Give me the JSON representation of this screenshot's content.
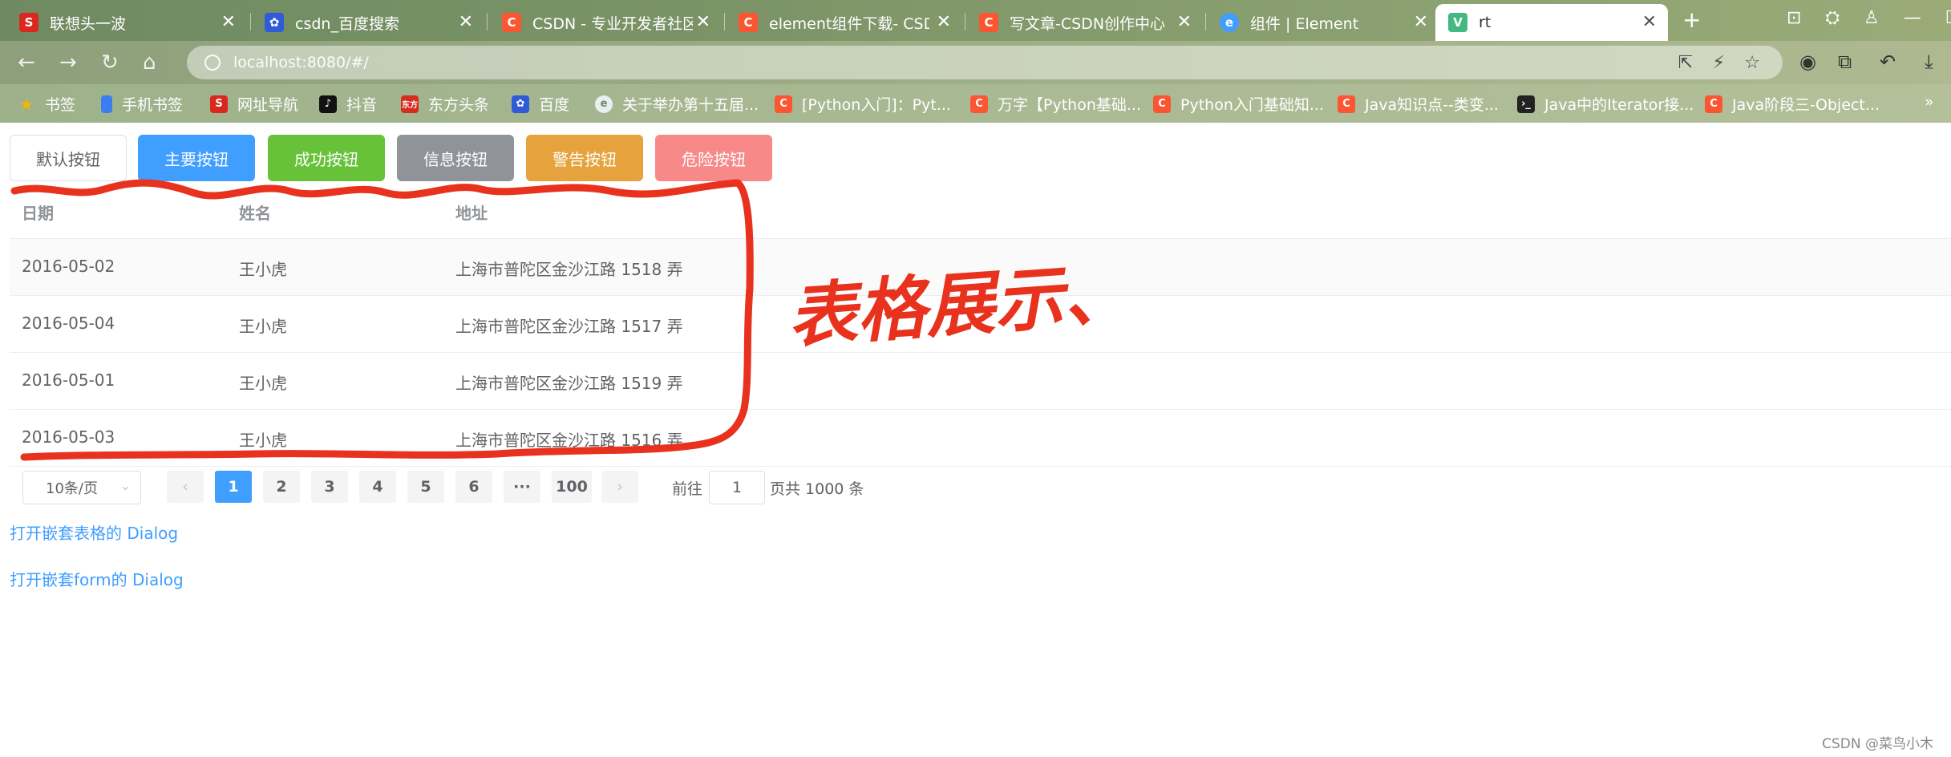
{
  "browser": {
    "tabs": [
      {
        "title": "联想头一波",
        "icon": "sogou-icon",
        "color": "#d9281e"
      },
      {
        "title": "csdn_百度搜索",
        "icon": "baidu-paw-icon",
        "color": "#2f5bd9"
      },
      {
        "title": "CSDN - 专业开发者社区",
        "icon": "csdn-icon",
        "color": "#fc5531"
      },
      {
        "title": "element组件下载- CSDN",
        "icon": "csdn-icon",
        "color": "#fc5531"
      },
      {
        "title": "写文章-CSDN创作中心",
        "icon": "csdn-icon",
        "color": "#fc5531"
      },
      {
        "title": "组件 | Element",
        "icon": "element-icon",
        "color": "#409eff"
      },
      {
        "title": "rt",
        "icon": "vue-icon",
        "color": "#42b883"
      }
    ],
    "new_tab": "+",
    "url": "localhost:8080/#/",
    "bookmarks": [
      {
        "label": "书签",
        "icon": "star-icon"
      },
      {
        "label": "手机书签",
        "icon": "phone-icon"
      },
      {
        "label": "网址导航",
        "icon": "sogou-icon"
      },
      {
        "label": "抖音",
        "icon": "tiktok-icon"
      },
      {
        "label": "东方头条",
        "icon": "dongfang-icon"
      },
      {
        "label": "百度",
        "icon": "baidu-paw-icon"
      },
      {
        "label": "关于举办第十五届...",
        "icon": "e-icon"
      },
      {
        "label": "[Python入门]：Pyt...",
        "icon": "csdn-icon"
      },
      {
        "label": "万字【Python基础...",
        "icon": "csdn-icon"
      },
      {
        "label": "Python入门基础知...",
        "icon": "csdn-icon"
      },
      {
        "label": "Java知识点--类变...",
        "icon": "csdn-icon"
      },
      {
        "label": "Java中的Iterator接...",
        "icon": "terminal-icon"
      },
      {
        "label": "Java阶段三-Object...",
        "icon": "csdn-icon"
      }
    ],
    "bookmarks_more": "»"
  },
  "buttons": {
    "default": "默认按钮",
    "primary": "主要按钮",
    "success": "成功按钮",
    "info": "信息按钮",
    "warning": "警告按钮",
    "danger": "危险按钮"
  },
  "table": {
    "headers": {
      "date": "日期",
      "name": "姓名",
      "address": "地址"
    },
    "rows": [
      {
        "date": "2016-05-02",
        "name": "王小虎",
        "address": "上海市普陀区金沙江路 1518 弄"
      },
      {
        "date": "2016-05-04",
        "name": "王小虎",
        "address": "上海市普陀区金沙江路 1517 弄"
      },
      {
        "date": "2016-05-01",
        "name": "王小虎",
        "address": "上海市普陀区金沙江路 1519 弄"
      },
      {
        "date": "2016-05-03",
        "name": "王小虎",
        "address": "上海市普陀区金沙江路 1516 弄"
      }
    ]
  },
  "pagination": {
    "page_size": "10条/页",
    "prev": "‹",
    "pages": [
      "1",
      "2",
      "3",
      "4",
      "5",
      "6"
    ],
    "ellipsis": "···",
    "last": "100",
    "next": "›",
    "goto_label": "前往",
    "goto_value": "1",
    "total_label": "页共 1000 条",
    "current": 1
  },
  "links": {
    "nested_table": "打开嵌套表格的 Dialog",
    "nested_form": "打开嵌套form的 Dialog"
  },
  "annotation": {
    "text": "表格展示、",
    "color": "#e8321e"
  },
  "watermark": "CSDN @菜鸟小木"
}
